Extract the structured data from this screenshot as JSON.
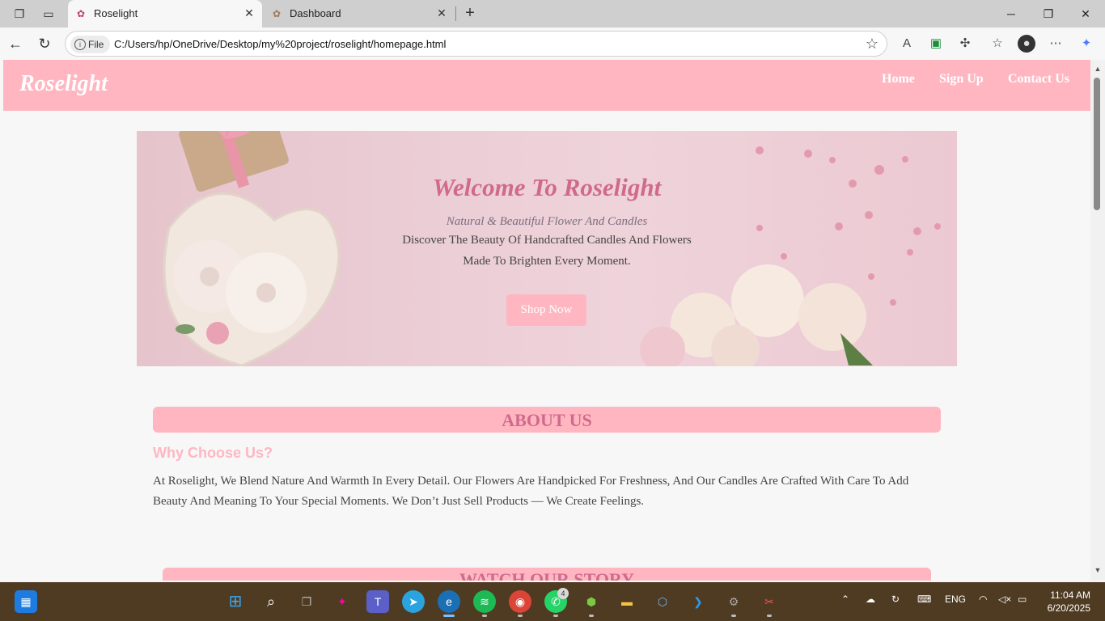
{
  "browser": {
    "tabs": [
      {
        "title": "Roselight",
        "active": true
      },
      {
        "title": "Dashboard",
        "active": false
      }
    ],
    "url_badge": "File",
    "url": "C:/Users/hp/OneDrive/Desktop/my%20project/roselight/homepage.html"
  },
  "site": {
    "brand": "Roselight",
    "nav": [
      "Home",
      "Sign Up",
      "Contact Us"
    ],
    "hero": {
      "title": "Welcome To Roselight",
      "subtitle": "Natural & Beautiful Flower And Candles",
      "description": "Discover The Beauty Of Handcrafted Candles And Flowers Made To Brighten Every Moment.",
      "button": "Shop Now"
    },
    "about": {
      "heading": "ABOUT US",
      "subheading": "Why Choose Us?",
      "text": "At Roselight, We Blend Nature And Warmth In Every Detail. Our Flowers Are Handpicked For Freshness, And Our Candles Are Crafted With Care To Add Beauty And Meaning To Your Special Moments. We Don’t Just Sell Products — We Create Feelings."
    },
    "story": {
      "heading": "WATCH OUR STORY"
    }
  },
  "taskbar": {
    "whatsapp_badge": "4",
    "language": "ENG",
    "time": "11:04 AM",
    "date": "6/20/2025"
  },
  "colors": {
    "brand_pink": "#ffb6c1",
    "accent_rose": "#d06a8c",
    "taskbar": "#4f3b22"
  }
}
